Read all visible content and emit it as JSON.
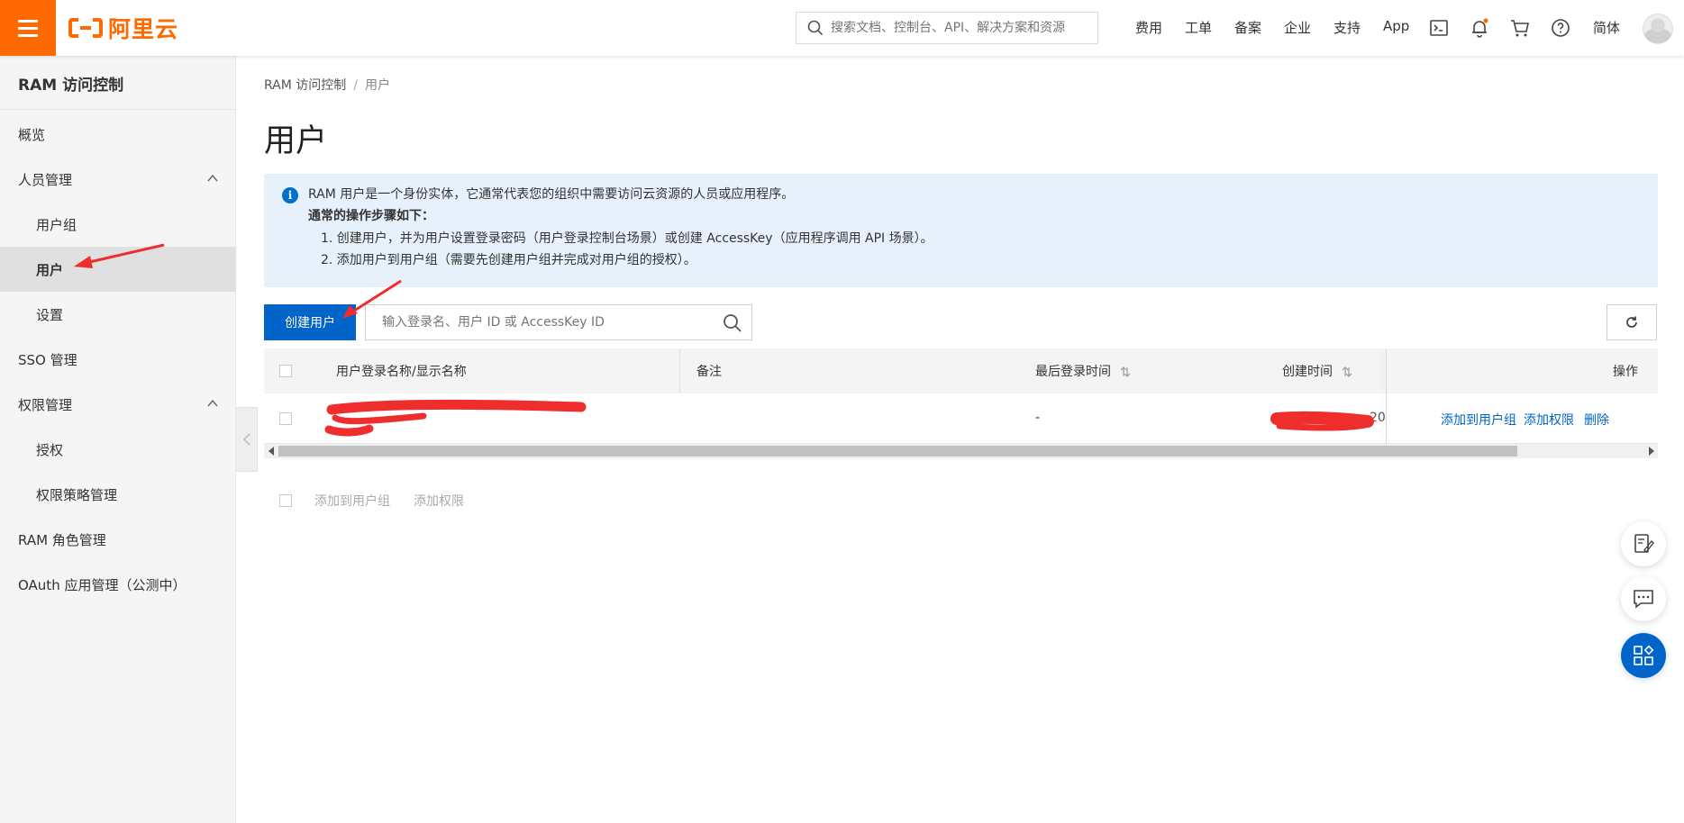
{
  "header": {
    "logo_text": "阿里云",
    "search_placeholder": "搜索文档、控制台、API、解决方案和资源",
    "nav": [
      "费用",
      "工单",
      "备案",
      "企业",
      "支持",
      "App"
    ],
    "language": "简体",
    "icons": [
      "menu-icon",
      "terminal-icon",
      "bell-icon",
      "cart-icon",
      "help-icon",
      "avatar"
    ],
    "brand_color": "#ff6a00"
  },
  "sidebar": {
    "title": "RAM 访问控制",
    "items": [
      {
        "label": "概览",
        "level": 1
      },
      {
        "label": "人员管理",
        "level": 1,
        "expanded": true
      },
      {
        "label": "用户组",
        "level": 2
      },
      {
        "label": "用户",
        "level": 2,
        "active": true
      },
      {
        "label": "设置",
        "level": 2
      },
      {
        "label": "SSO 管理",
        "level": 1
      },
      {
        "label": "权限管理",
        "level": 1,
        "expanded": true
      },
      {
        "label": "授权",
        "level": 2
      },
      {
        "label": "权限策略管理",
        "level": 2
      },
      {
        "label": "RAM 角色管理",
        "level": 1
      },
      {
        "label": "OAuth 应用管理（公测中）",
        "level": 1
      }
    ]
  },
  "breadcrumb": {
    "root": "RAM 访问控制",
    "sep": "/",
    "current": "用户"
  },
  "page_title": "用户",
  "info": {
    "line1": "RAM 用户是一个身份实体，它通常代表您的组织中需要访问云资源的人员或应用程序。",
    "heading": "通常的操作步骤如下：",
    "step1": "1. 创建用户，并为用户设置登录密码（用户登录控制台场景）或创建 AccessKey（应用程序调用 API 场景）。",
    "step2": "2. 添加用户到用户组（需要先创建用户组并完成对用户组的授权）。"
  },
  "toolbar": {
    "create_label": "创建用户",
    "search_placeholder": "输入登录名、用户 ID 或 AccessKey ID"
  },
  "table": {
    "columns": [
      "用户登录名称/显示名称",
      "备注",
      "最后登录时间",
      "创建时间",
      "操作"
    ],
    "rows": [
      {
        "remark": "",
        "last_login": "-",
        "created_suffix": "20",
        "actions": [
          "添加到用户组",
          "添加权限",
          "删除"
        ]
      }
    ]
  },
  "batch_actions": [
    "添加到用户组",
    "添加权限"
  ],
  "colors": {
    "primary": "#0064c8",
    "info_bg": "#e6f1fc",
    "annotation": "#f02d2d"
  }
}
